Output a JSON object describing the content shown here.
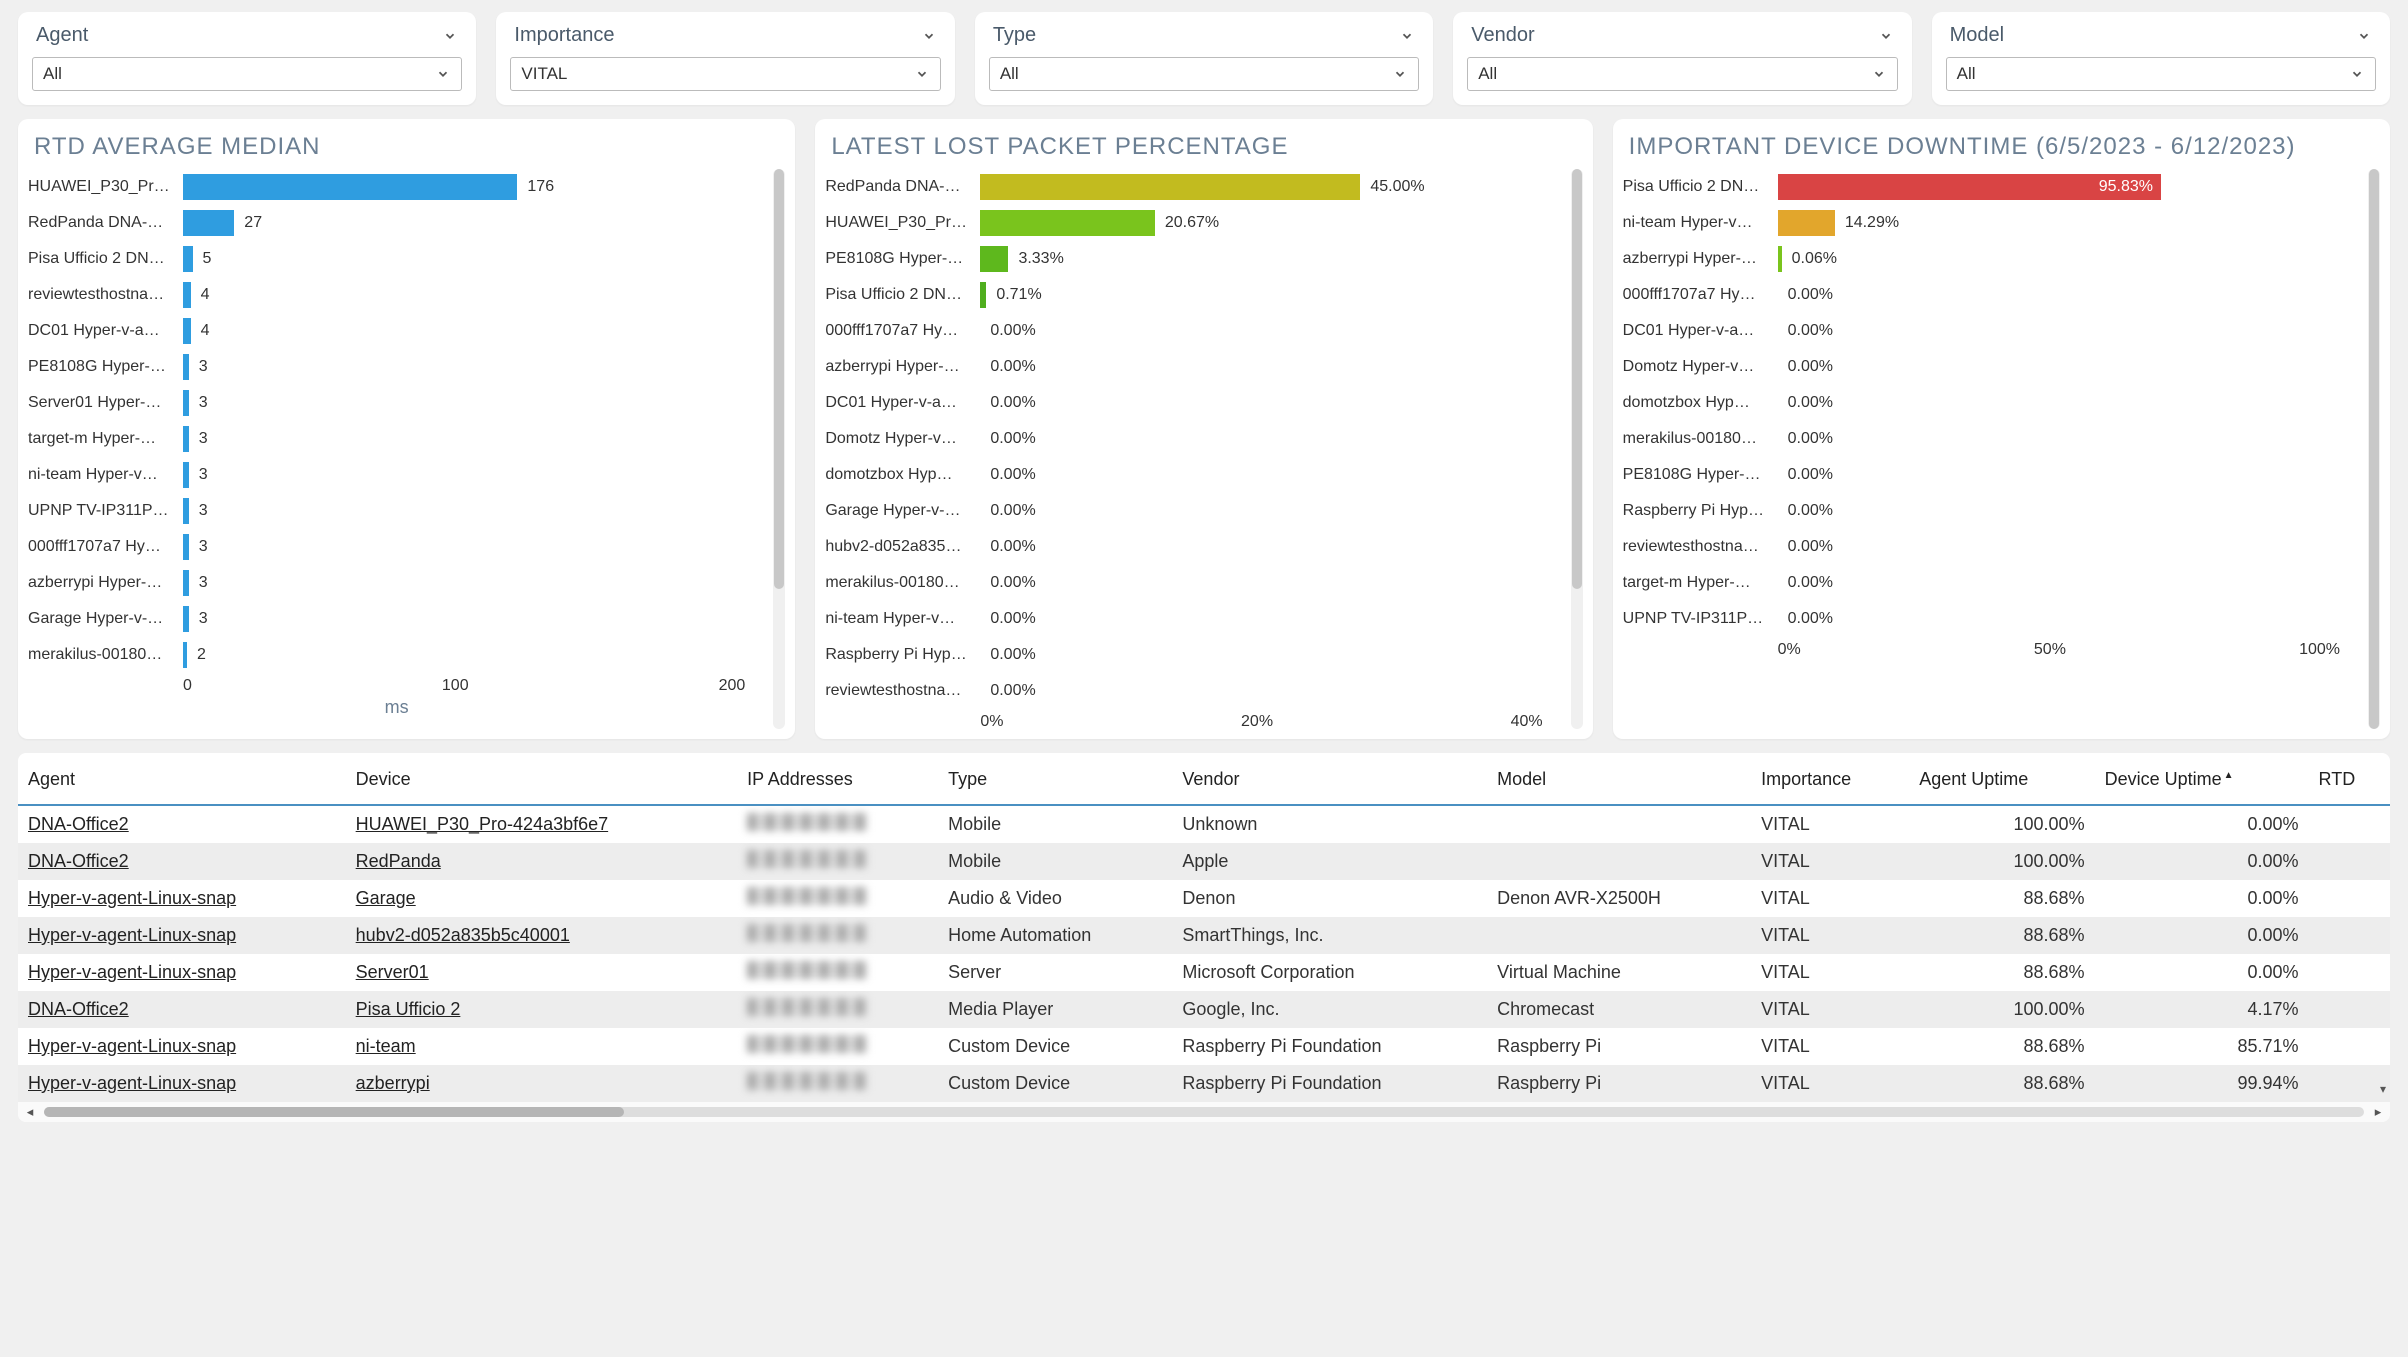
{
  "filters": [
    {
      "label": "Agent",
      "value": "All"
    },
    {
      "label": "Importance",
      "value": "VITAL"
    },
    {
      "label": "Type",
      "value": "All"
    },
    {
      "label": "Vendor",
      "value": "All"
    },
    {
      "label": "Model",
      "value": "All"
    }
  ],
  "chart_data": [
    {
      "type": "bar",
      "orientation": "horizontal",
      "title": "RTD AVERAGE MEDIAN",
      "xlabel": "ms",
      "xlim": [
        0,
        200
      ],
      "xticks": [
        0,
        100,
        200
      ],
      "categories": [
        "HUAWEI_P30_Pr…",
        "RedPanda DNA-…",
        "Pisa Ufficio 2 DN…",
        "reviewtesthostna…",
        "DC01 Hyper-v-a…",
        "PE8108G Hyper-…",
        "Server01 Hyper-…",
        "target-m Hyper-…",
        "ni-team Hyper-v…",
        "UPNP TV-IP311P…",
        "000fff1707a7 Hy…",
        "azberrypi Hyper-…",
        "Garage Hyper-v-…",
        "merakilus-00180…"
      ],
      "values": [
        176,
        27,
        5,
        4,
        4,
        3,
        3,
        3,
        3,
        3,
        3,
        3,
        3,
        2
      ],
      "value_labels": [
        "176",
        "27",
        "5",
        "4",
        "4",
        "3",
        "3",
        "3",
        "3",
        "3",
        "3",
        "3",
        "3",
        "2"
      ],
      "color": "#2f9de0"
    },
    {
      "type": "bar",
      "orientation": "horizontal",
      "title": "LATEST LOST PACKET PERCENTAGE",
      "xlim": [
        0,
        45
      ],
      "xticks_labels": [
        "0%",
        "20%",
        "40%"
      ],
      "xticks": [
        0,
        20,
        40
      ],
      "categories": [
        "RedPanda DNA-…",
        "HUAWEI_P30_Pr…",
        "PE8108G Hyper-…",
        "Pisa Ufficio 2 DN…",
        "000fff1707a7 Hy…",
        "azberrypi Hyper-…",
        "DC01 Hyper-v-a…",
        "Domotz Hyper-v…",
        "domotzbox Hyp…",
        "Garage Hyper-v-…",
        "hubv2-d052a835…",
        "merakilus-00180…",
        "ni-team Hyper-v…",
        "Raspberry Pi Hyp…",
        "reviewtesthostna…"
      ],
      "values": [
        45.0,
        20.67,
        3.33,
        0.71,
        0,
        0,
        0,
        0,
        0,
        0,
        0,
        0,
        0,
        0,
        0
      ],
      "value_labels": [
        "45.00%",
        "20.67%",
        "3.33%",
        "0.71%",
        "0.00%",
        "0.00%",
        "0.00%",
        "0.00%",
        "0.00%",
        "0.00%",
        "0.00%",
        "0.00%",
        "0.00%",
        "0.00%",
        "0.00%"
      ],
      "colors": [
        "#c2bb1f",
        "#7ac41d",
        "#5eb81d",
        "#4fae1e",
        "#4fae1e",
        "#4fae1e",
        "#4fae1e",
        "#4fae1e",
        "#4fae1e",
        "#4fae1e",
        "#4fae1e",
        "#4fae1e",
        "#4fae1e",
        "#4fae1e",
        "#4fae1e"
      ]
    },
    {
      "type": "bar",
      "orientation": "horizontal",
      "title": "IMPORTANT DEVICE DOWNTIME (6/5/2023 - 6/12/2023)",
      "xlim": [
        0,
        100
      ],
      "xticks_labels": [
        "0%",
        "50%",
        "100%"
      ],
      "xticks": [
        0,
        50,
        100
      ],
      "categories": [
        "Pisa Ufficio 2 DN…",
        "ni-team Hyper-v…",
        "azberrypi Hyper-…",
        "000fff1707a7 Hy…",
        "DC01 Hyper-v-a…",
        "Domotz Hyper-v…",
        "domotzbox Hyp…",
        "merakilus-00180…",
        "PE8108G Hyper-…",
        "Raspberry Pi Hyp…",
        "reviewtesthostna…",
        "target-m Hyper-…",
        "UPNP TV-IP311P…"
      ],
      "values": [
        95.83,
        14.29,
        0.06,
        0,
        0,
        0,
        0,
        0,
        0,
        0,
        0,
        0,
        0
      ],
      "value_labels": [
        "95.83%",
        "14.29%",
        "0.06%",
        "0.00%",
        "0.00%",
        "0.00%",
        "0.00%",
        "0.00%",
        "0.00%",
        "0.00%",
        "0.00%",
        "0.00%",
        "0.00%"
      ],
      "colors": [
        "#d94444",
        "#e2a62c",
        "#7ac41d",
        "#7ac41d",
        "#7ac41d",
        "#7ac41d",
        "#7ac41d",
        "#7ac41d",
        "#7ac41d",
        "#7ac41d",
        "#7ac41d",
        "#7ac41d",
        "#7ac41d"
      ]
    }
  ],
  "table": {
    "columns": [
      "Agent",
      "Device",
      "IP Addresses",
      "Type",
      "Vendor",
      "Model",
      "Importance",
      "Agent Uptime",
      "Device Uptime",
      "RTD"
    ],
    "sort_col": "Device Uptime",
    "rows": [
      {
        "agent": "DNA-Office2",
        "device": "HUAWEI_P30_Pro-424a3bf6e7",
        "type": "Mobile",
        "vendor": "Unknown",
        "model": "",
        "importance": "VITAL",
        "agent_uptime": "100.00%",
        "device_uptime": "0.00%"
      },
      {
        "agent": "DNA-Office2",
        "device": "RedPanda",
        "type": "Mobile",
        "vendor": "Apple",
        "model": "",
        "importance": "VITAL",
        "agent_uptime": "100.00%",
        "device_uptime": "0.00%"
      },
      {
        "agent": "Hyper-v-agent-Linux-snap",
        "device": "Garage",
        "type": "Audio & Video",
        "vendor": "Denon",
        "model": "Denon AVR-X2500H",
        "importance": "VITAL",
        "agent_uptime": "88.68%",
        "device_uptime": "0.00%"
      },
      {
        "agent": "Hyper-v-agent-Linux-snap",
        "device": "hubv2-d052a835b5c40001",
        "type": "Home Automation",
        "vendor": "SmartThings, Inc.",
        "model": "",
        "importance": "VITAL",
        "agent_uptime": "88.68%",
        "device_uptime": "0.00%"
      },
      {
        "agent": "Hyper-v-agent-Linux-snap",
        "device": "Server01",
        "type": "Server",
        "vendor": "Microsoft Corporation",
        "model": "Virtual Machine",
        "importance": "VITAL",
        "agent_uptime": "88.68%",
        "device_uptime": "0.00%"
      },
      {
        "agent": "DNA-Office2",
        "device": "Pisa Ufficio 2",
        "type": "Media Player",
        "vendor": "Google, Inc.",
        "model": "Chromecast",
        "importance": "VITAL",
        "agent_uptime": "100.00%",
        "device_uptime": "4.17%"
      },
      {
        "agent": "Hyper-v-agent-Linux-snap",
        "device": "ni-team",
        "type": "Custom Device",
        "vendor": "Raspberry Pi Foundation",
        "model": "Raspberry Pi",
        "importance": "VITAL",
        "agent_uptime": "88.68%",
        "device_uptime": "85.71%"
      },
      {
        "agent": "Hyper-v-agent-Linux-snap",
        "device": "azberrypi",
        "type": "Custom Device",
        "vendor": "Raspberry Pi Foundation",
        "model": "Raspberry Pi",
        "importance": "VITAL",
        "agent_uptime": "88.68%",
        "device_uptime": "99.94%"
      }
    ]
  }
}
